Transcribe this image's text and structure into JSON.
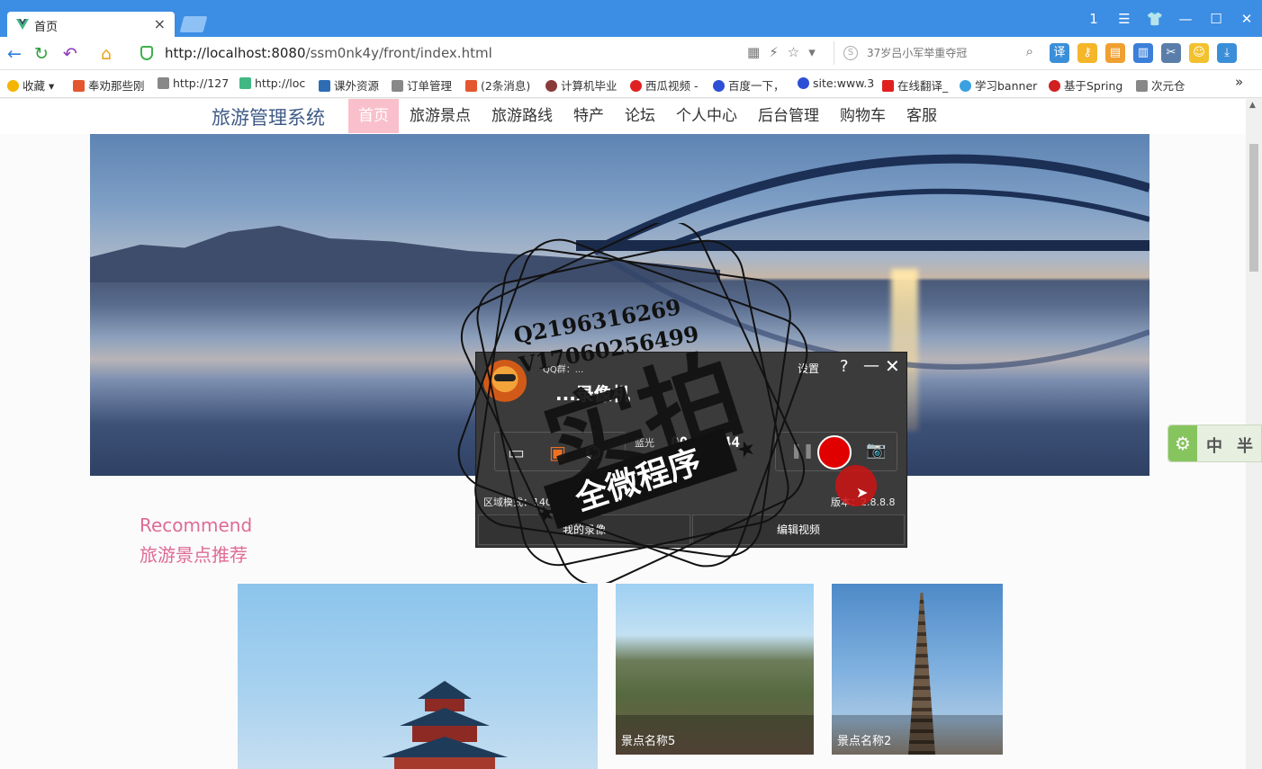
{
  "browser": {
    "tab_title": "首页",
    "tab_close": "×",
    "window_controls": [
      "1",
      "☰",
      "👕",
      "—",
      "☐",
      "✕"
    ],
    "url_host": "http://localhost:8080",
    "url_path": "/ssm0nk4y/front/index.html",
    "search_placeholder": "37岁吕小军举重夺冠",
    "bookmarks": [
      {
        "label": "收藏",
        "color": "#f4b400"
      },
      {
        "label": "奉劝那些刚",
        "color": "#e4572e"
      },
      {
        "label": "http://127",
        "color": "#888888"
      },
      {
        "label": "http://loc",
        "color": "#41b883"
      },
      {
        "label": "课外资源",
        "color": "#2e6db4"
      },
      {
        "label": "订单管理",
        "color": "#888888"
      },
      {
        "label": "(2条消息)",
        "color": "#e4572e"
      },
      {
        "label": "计算机毕业",
        "color": "#8b3a3a"
      },
      {
        "label": "西瓜视频 -",
        "color": "#e02020"
      },
      {
        "label": "百度一下，",
        "color": "#2d4fd6"
      },
      {
        "label": "site:www.3",
        "color": "#2d4fd6"
      },
      {
        "label": "在线翻译_",
        "color": "#e02020"
      },
      {
        "label": "学习banner",
        "color": "#3aa0e0"
      },
      {
        "label": "基于Spring",
        "color": "#d02020"
      },
      {
        "label": "次元仓",
        "color": "#888888"
      }
    ],
    "more": "»"
  },
  "site": {
    "brand": "旅游管理系统",
    "menu": [
      "首页",
      "旅游景点",
      "旅游路线",
      "特产",
      "论坛",
      "个人中心",
      "后台管理",
      "购物车",
      "客服"
    ],
    "recommend_en": "Recommend",
    "recommend_cn": "旅游景点推荐",
    "cards": [
      {
        "caption": ""
      },
      {
        "caption": "景点名称5"
      },
      {
        "caption": "景点名称2"
      }
    ]
  },
  "side_widget": {
    "icon": "⚙",
    "t1": "中",
    "t2": "半"
  },
  "recorder": {
    "qq": "QQ群：...",
    "name": "...录像机",
    "settings": "设置",
    "help": "?",
    "minimize": "—",
    "close": "✕",
    "lan": "蓝光",
    "timer": "00:01:44",
    "area_mode": "区域模式：1402 x 855",
    "version": "版本：2.8.8.8",
    "btn_my_videos": "我的录像",
    "btn_edit_video": "编辑视频"
  },
  "watermark": {
    "line1": "Q2196316269",
    "line2": "V17060256499",
    "big": "实拍",
    "slogan": "全微程序"
  }
}
